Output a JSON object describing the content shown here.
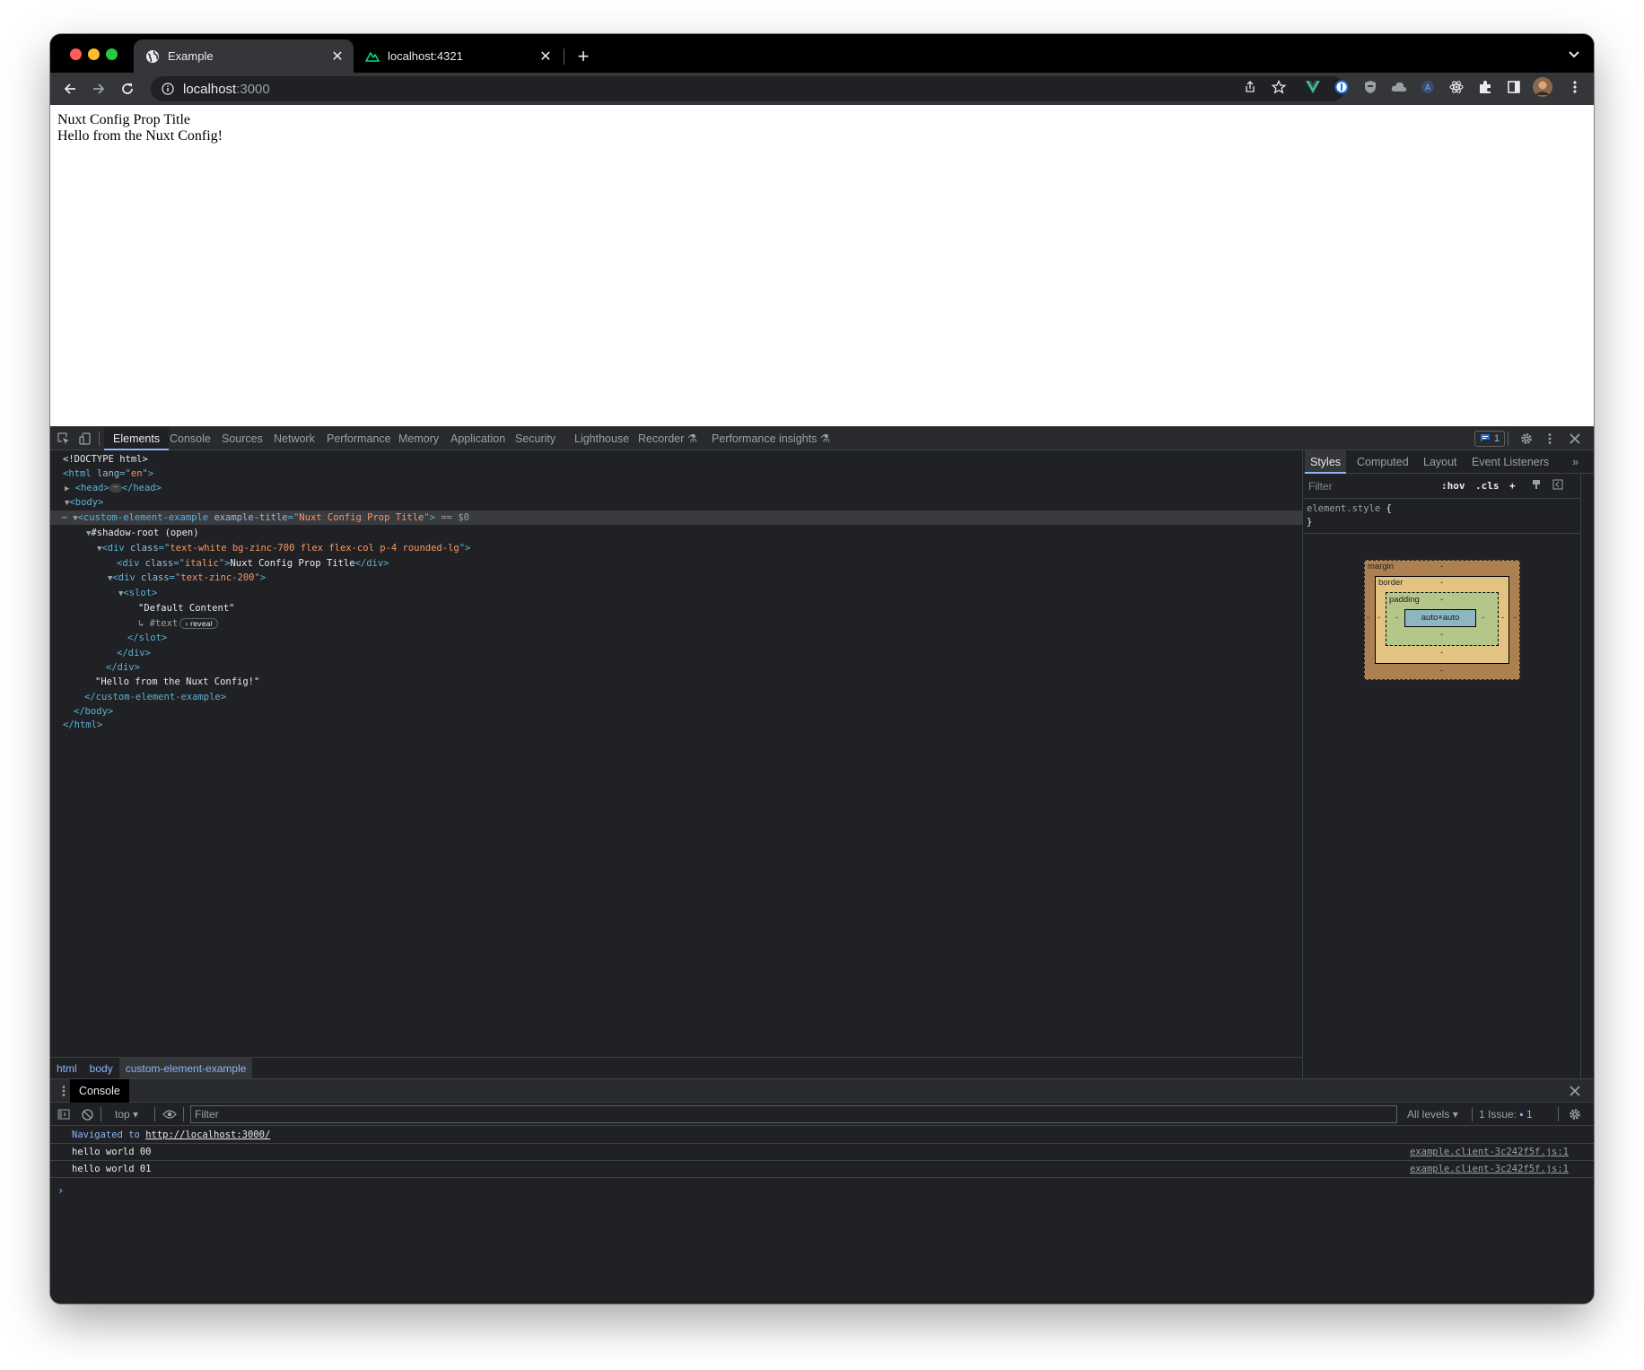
{
  "browser": {
    "tabs": [
      {
        "title": "Example",
        "icon": "globe-icon",
        "active": true
      },
      {
        "title": "localhost:4321",
        "icon": "astro-icon",
        "active": false
      }
    ],
    "address": {
      "host": "localhost",
      "port": ":3000"
    }
  },
  "page": {
    "line1": "Nuxt Config Prop Title",
    "line2": "Hello from the Nuxt Config!"
  },
  "devtools": {
    "tabs": [
      "Elements",
      "Console",
      "Sources",
      "Network",
      "Performance",
      "Memory",
      "Application",
      "Security",
      "Lighthouse",
      "Recorder",
      "Performance insights"
    ],
    "active_tab": "Elements",
    "issues_badge": "1",
    "elements": {
      "doctype": "<!DOCTYPE html>",
      "html_open_tag": "<html",
      "html_attr": "lang",
      "html_attr_val": "en",
      "head_open": "<head>",
      "head_close": "</head>",
      "body_open": "<body>",
      "ce_open_tag": "<custom-element-example",
      "ce_attr": "example-title",
      "ce_attr_val": "Nuxt Config Prop Title",
      "ce_suffix": "== $0",
      "shadow_root": "#shadow-root (open)",
      "div1_tag": "<div",
      "div1_attr": "class",
      "div1_val": "text-white bg-zinc-700 flex flex-col p-4 rounded-lg",
      "div2_tag": "<div",
      "div2_attr": "class",
      "div2_val": "italic",
      "div2_text": "Nuxt Config Prop Title",
      "div2_close": "</div>",
      "div3_tag": "<div",
      "div3_attr": "class",
      "div3_val": "text-zinc-200",
      "slot_open": "<slot>",
      "default_content": "\"Default Content\"",
      "text_node": "#text",
      "reveal": "reveal",
      "slot_close": "</slot>",
      "div3_close": "</div>",
      "div1_close": "</div>",
      "hello_text": "\"Hello from the Nuxt Config!\"",
      "ce_close": "</custom-element-example>",
      "body_close": "</body>",
      "html_close": "</html>"
    },
    "breadcrumbs": [
      "html",
      "body",
      "custom-element-example"
    ],
    "styles": {
      "tabs": [
        "Styles",
        "Computed",
        "Layout",
        "Event Listeners"
      ],
      "filter_placeholder": "Filter",
      "hov": ":hov",
      "cls": ".cls",
      "selector": "element.style",
      "brace_open": "{",
      "brace_close": "}",
      "box_model": {
        "margin_label": "margin",
        "border_label": "border",
        "padding_label": "padding",
        "content": "auto×auto",
        "dash": "-"
      }
    },
    "console": {
      "tab": "Console",
      "context": "top",
      "filter_placeholder": "Filter",
      "levels": "All levels",
      "issues": "1 Issue:",
      "issues_count": "1",
      "messages": {
        "navigated_prefix": "Navigated to",
        "navigated_url": "http://localhost:3000/",
        "msg1": "hello world 00",
        "msg1_src": "example.client-3c242f5f.js:1",
        "msg2": "hello world 01",
        "msg2_src": "example.client-3c242f5f.js:1"
      }
    }
  }
}
